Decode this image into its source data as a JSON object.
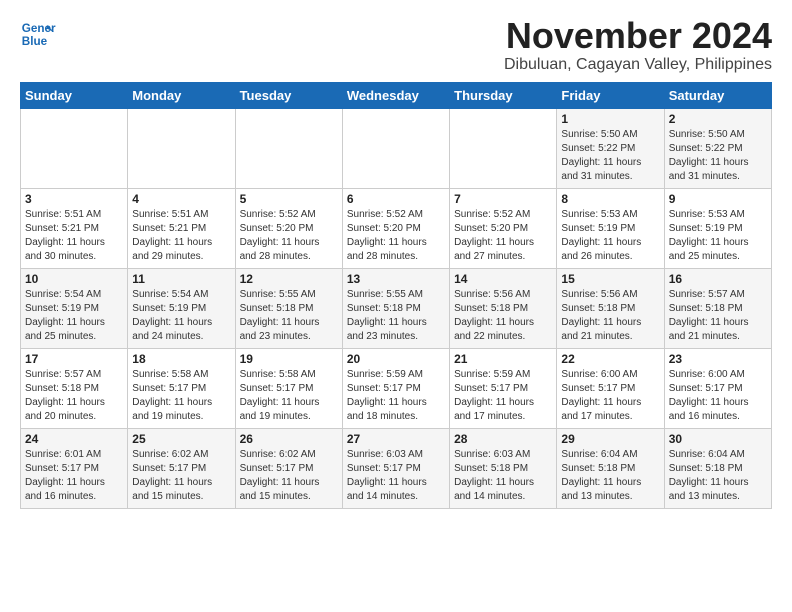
{
  "header": {
    "logo_line1": "General",
    "logo_line2": "Blue",
    "month": "November 2024",
    "location": "Dibuluan, Cagayan Valley, Philippines"
  },
  "weekdays": [
    "Sunday",
    "Monday",
    "Tuesday",
    "Wednesday",
    "Thursday",
    "Friday",
    "Saturday"
  ],
  "weeks": [
    [
      {
        "day": "",
        "info": ""
      },
      {
        "day": "",
        "info": ""
      },
      {
        "day": "",
        "info": ""
      },
      {
        "day": "",
        "info": ""
      },
      {
        "day": "",
        "info": ""
      },
      {
        "day": "1",
        "info": "Sunrise: 5:50 AM\nSunset: 5:22 PM\nDaylight: 11 hours\nand 31 minutes."
      },
      {
        "day": "2",
        "info": "Sunrise: 5:50 AM\nSunset: 5:22 PM\nDaylight: 11 hours\nand 31 minutes."
      }
    ],
    [
      {
        "day": "3",
        "info": "Sunrise: 5:51 AM\nSunset: 5:21 PM\nDaylight: 11 hours\nand 30 minutes."
      },
      {
        "day": "4",
        "info": "Sunrise: 5:51 AM\nSunset: 5:21 PM\nDaylight: 11 hours\nand 29 minutes."
      },
      {
        "day": "5",
        "info": "Sunrise: 5:52 AM\nSunset: 5:20 PM\nDaylight: 11 hours\nand 28 minutes."
      },
      {
        "day": "6",
        "info": "Sunrise: 5:52 AM\nSunset: 5:20 PM\nDaylight: 11 hours\nand 28 minutes."
      },
      {
        "day": "7",
        "info": "Sunrise: 5:52 AM\nSunset: 5:20 PM\nDaylight: 11 hours\nand 27 minutes."
      },
      {
        "day": "8",
        "info": "Sunrise: 5:53 AM\nSunset: 5:19 PM\nDaylight: 11 hours\nand 26 minutes."
      },
      {
        "day": "9",
        "info": "Sunrise: 5:53 AM\nSunset: 5:19 PM\nDaylight: 11 hours\nand 25 minutes."
      }
    ],
    [
      {
        "day": "10",
        "info": "Sunrise: 5:54 AM\nSunset: 5:19 PM\nDaylight: 11 hours\nand 25 minutes."
      },
      {
        "day": "11",
        "info": "Sunrise: 5:54 AM\nSunset: 5:19 PM\nDaylight: 11 hours\nand 24 minutes."
      },
      {
        "day": "12",
        "info": "Sunrise: 5:55 AM\nSunset: 5:18 PM\nDaylight: 11 hours\nand 23 minutes."
      },
      {
        "day": "13",
        "info": "Sunrise: 5:55 AM\nSunset: 5:18 PM\nDaylight: 11 hours\nand 23 minutes."
      },
      {
        "day": "14",
        "info": "Sunrise: 5:56 AM\nSunset: 5:18 PM\nDaylight: 11 hours\nand 22 minutes."
      },
      {
        "day": "15",
        "info": "Sunrise: 5:56 AM\nSunset: 5:18 PM\nDaylight: 11 hours\nand 21 minutes."
      },
      {
        "day": "16",
        "info": "Sunrise: 5:57 AM\nSunset: 5:18 PM\nDaylight: 11 hours\nand 21 minutes."
      }
    ],
    [
      {
        "day": "17",
        "info": "Sunrise: 5:57 AM\nSunset: 5:18 PM\nDaylight: 11 hours\nand 20 minutes."
      },
      {
        "day": "18",
        "info": "Sunrise: 5:58 AM\nSunset: 5:17 PM\nDaylight: 11 hours\nand 19 minutes."
      },
      {
        "day": "19",
        "info": "Sunrise: 5:58 AM\nSunset: 5:17 PM\nDaylight: 11 hours\nand 19 minutes."
      },
      {
        "day": "20",
        "info": "Sunrise: 5:59 AM\nSunset: 5:17 PM\nDaylight: 11 hours\nand 18 minutes."
      },
      {
        "day": "21",
        "info": "Sunrise: 5:59 AM\nSunset: 5:17 PM\nDaylight: 11 hours\nand 17 minutes."
      },
      {
        "day": "22",
        "info": "Sunrise: 6:00 AM\nSunset: 5:17 PM\nDaylight: 11 hours\nand 17 minutes."
      },
      {
        "day": "23",
        "info": "Sunrise: 6:00 AM\nSunset: 5:17 PM\nDaylight: 11 hours\nand 16 minutes."
      }
    ],
    [
      {
        "day": "24",
        "info": "Sunrise: 6:01 AM\nSunset: 5:17 PM\nDaylight: 11 hours\nand 16 minutes."
      },
      {
        "day": "25",
        "info": "Sunrise: 6:02 AM\nSunset: 5:17 PM\nDaylight: 11 hours\nand 15 minutes."
      },
      {
        "day": "26",
        "info": "Sunrise: 6:02 AM\nSunset: 5:17 PM\nDaylight: 11 hours\nand 15 minutes."
      },
      {
        "day": "27",
        "info": "Sunrise: 6:03 AM\nSunset: 5:17 PM\nDaylight: 11 hours\nand 14 minutes."
      },
      {
        "day": "28",
        "info": "Sunrise: 6:03 AM\nSunset: 5:18 PM\nDaylight: 11 hours\nand 14 minutes."
      },
      {
        "day": "29",
        "info": "Sunrise: 6:04 AM\nSunset: 5:18 PM\nDaylight: 11 hours\nand 13 minutes."
      },
      {
        "day": "30",
        "info": "Sunrise: 6:04 AM\nSunset: 5:18 PM\nDaylight: 11 hours\nand 13 minutes."
      }
    ]
  ]
}
